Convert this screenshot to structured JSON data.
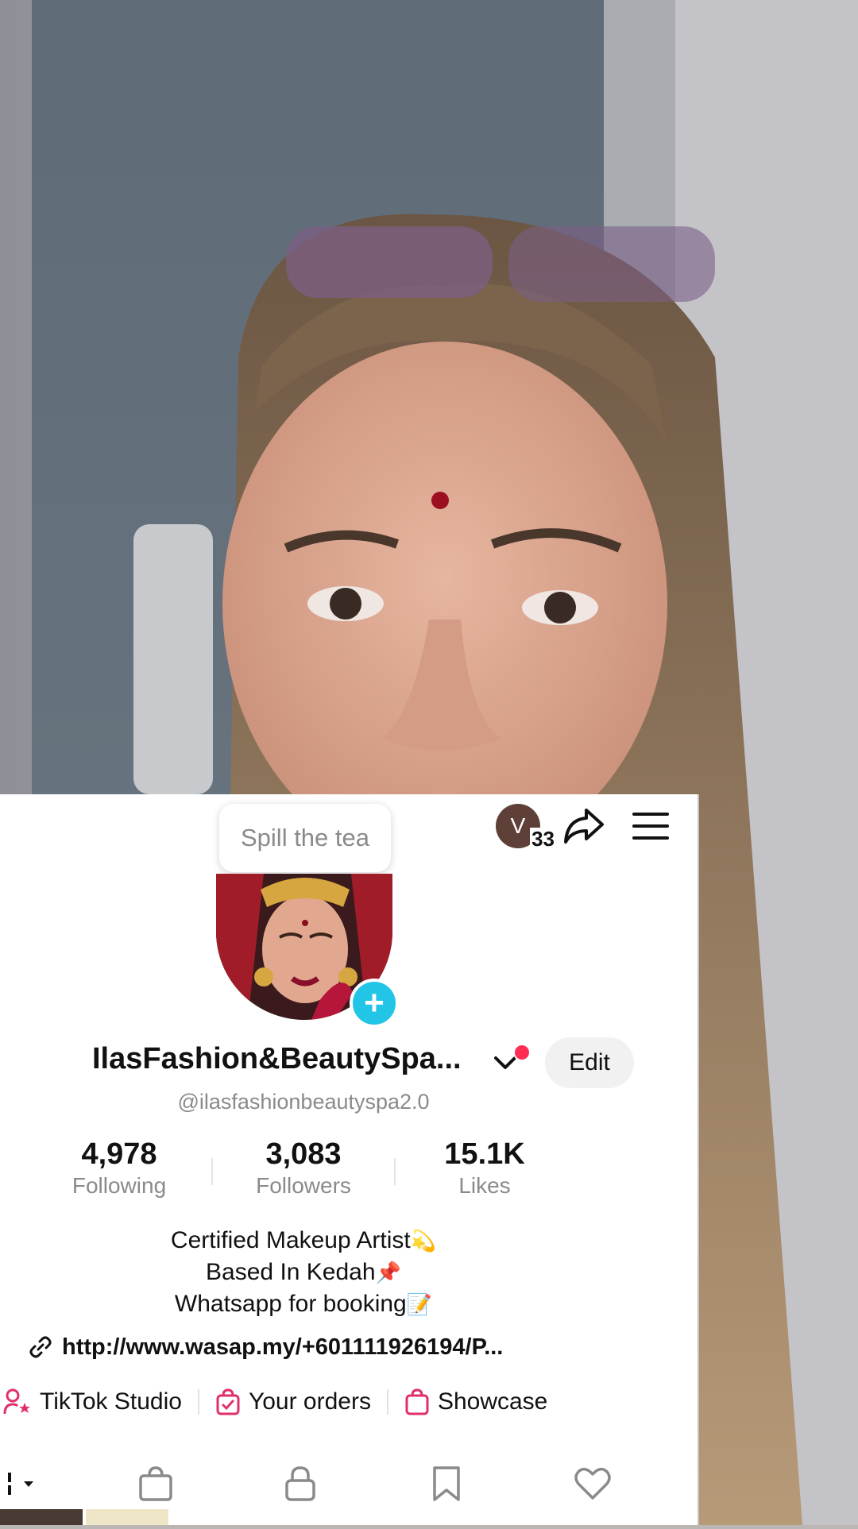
{
  "tooltip": {
    "text": "Spill the tea"
  },
  "header": {
    "avatar_initial": "V",
    "avatar_count": "33",
    "share_icon": "share-arrow-icon",
    "menu_icon": "hamburger-menu-icon"
  },
  "profile": {
    "display_name": "IlasFashion&BeautySpa...",
    "username": "@ilasfashionbeautyspa2.0",
    "edit_label": "Edit",
    "add_icon": "plus-icon"
  },
  "stats": [
    {
      "value": "4,978",
      "label": "Following"
    },
    {
      "value": "3,083",
      "label": "Followers"
    },
    {
      "value": "15.1K",
      "label": "Likes"
    }
  ],
  "bio": {
    "line1": "Certified Makeup Artist",
    "line1_emoji": "💫",
    "line2": "Based In Kedah",
    "line2_emoji": "📌",
    "line3": "Whatsapp for booking",
    "line3_emoji": "📝"
  },
  "link": {
    "url": "http://www.wasap.my/+601111926194/P..."
  },
  "shortcuts": [
    {
      "label": "TikTok Studio",
      "icon": "creator-star-icon"
    },
    {
      "label": "Your orders",
      "icon": "order-bag-icon"
    },
    {
      "label": "Showcase",
      "icon": "shopping-bag-icon"
    }
  ],
  "tabs": [
    {
      "icon": "videos-grid-icon",
      "active": true
    },
    {
      "icon": "shop-bag-icon"
    },
    {
      "icon": "lock-icon"
    },
    {
      "icon": "bookmark-icon"
    },
    {
      "icon": "heart-icon"
    }
  ],
  "colors": {
    "accent_red": "#fe2c55",
    "add_badge": "#22c5e6",
    "pink_icon": "#e0306a",
    "text_primary": "#111111",
    "text_secondary": "#8a8a8a"
  }
}
